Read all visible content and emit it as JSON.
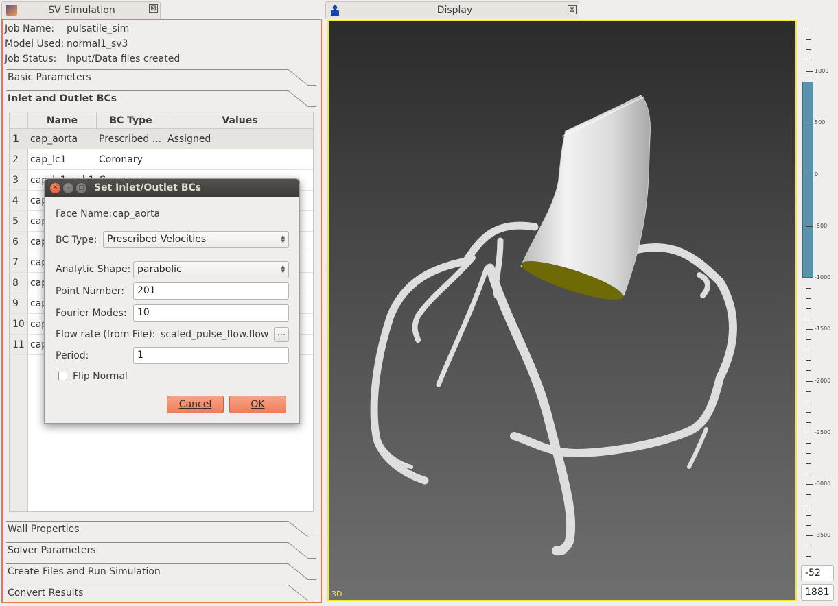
{
  "left_tab": {
    "title": "SV Simulation",
    "close": "⊠"
  },
  "job": {
    "name_label": "Job Name:",
    "name_value": "pulsatile_sim",
    "model_label": "Model Used:",
    "model_value": "normal1_sv3",
    "status_label": "Job Status:",
    "status_value": "Input/Data files created"
  },
  "sections": {
    "basic": "Basic Parameters",
    "bcs": "Inlet and Outlet BCs",
    "wall": "Wall Properties",
    "solver": "Solver Parameters",
    "create": "Create Files and Run Simulation",
    "convert": "Convert Results"
  },
  "table": {
    "headers": [
      "Name",
      "BC Type",
      "Values"
    ],
    "rows": [
      {
        "num": "1",
        "name": "cap_aorta",
        "type": "Prescribed ...",
        "values": "Assigned"
      },
      {
        "num": "2",
        "name": "cap_lc1",
        "type": "Coronary",
        "values": ""
      },
      {
        "num": "3",
        "name": "cap_lc1_sub1",
        "type": "Coronary",
        "values": ""
      },
      {
        "num": "4",
        "name": "cap",
        "type": "",
        "values": ""
      },
      {
        "num": "5",
        "name": "cap",
        "type": "",
        "values": ""
      },
      {
        "num": "6",
        "name": "cap",
        "type": "",
        "values": ""
      },
      {
        "num": "7",
        "name": "cap",
        "type": "",
        "values": ""
      },
      {
        "num": "8",
        "name": "cap",
        "type": "",
        "values": ""
      },
      {
        "num": "9",
        "name": "cap",
        "type": "",
        "values": ""
      },
      {
        "num": "10",
        "name": "cap",
        "type": "",
        "values": ""
      },
      {
        "num": "11",
        "name": "cap",
        "type": "",
        "values": ""
      }
    ]
  },
  "right_tab": {
    "title": "Display",
    "close": "⊠"
  },
  "viewport": {
    "mode_label": "3D"
  },
  "scale": {
    "labels": [
      "1000",
      "500",
      "0",
      "-500",
      "-1000",
      "-1500",
      "-2000",
      "-2500",
      "-3000",
      "-3500"
    ]
  },
  "coords": {
    "a": "-52",
    "b": "1881"
  },
  "dialog": {
    "title": "Set Inlet/Outlet BCs",
    "face_name_label": "Face Name:",
    "face_name_value": "cap_aorta",
    "bc_type_label": "BC Type:",
    "bc_type_value": "Prescribed Velocities",
    "analytic_shape_label": "Analytic Shape:",
    "analytic_shape_value": "parabolic",
    "point_number_label": "Point Number:",
    "point_number_value": "201",
    "fourier_label": "Fourier Modes:",
    "fourier_value": "10",
    "flow_rate_label": "Flow rate (from File):",
    "flow_rate_value": "scaled_pulse_flow.flow",
    "browse_label": "...",
    "period_label": "Period:",
    "period_value": "1",
    "flip_label": "Flip Normal",
    "flip_checked": false,
    "cancel_label": "Cancel",
    "ok_label": "OK"
  },
  "colors": {
    "panel_border": "#e07a4f",
    "viewport_border": "#f2ec2a",
    "button": "#ee7d58",
    "scale_bar": "#5b93ad"
  }
}
